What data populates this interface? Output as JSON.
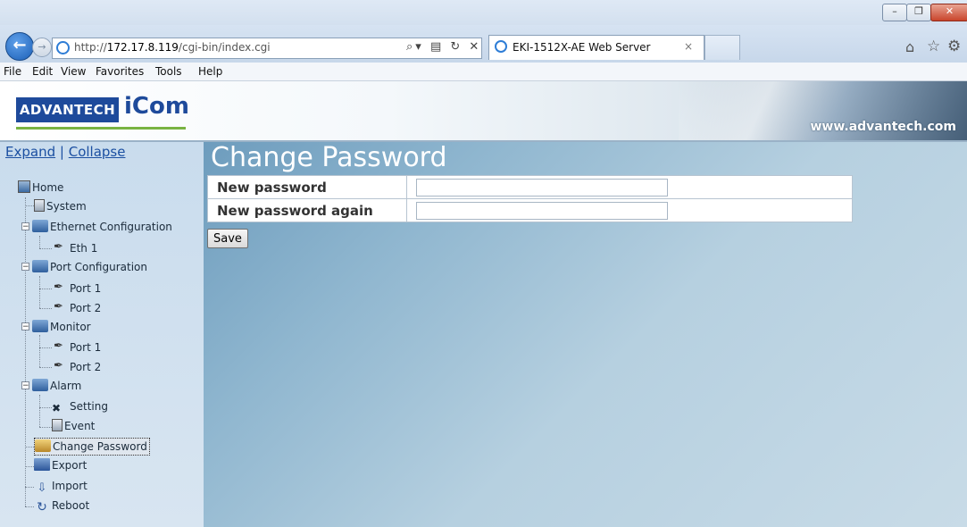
{
  "browser": {
    "window_buttons": {
      "minimize": "–",
      "maximize": "❐",
      "close": "✕"
    },
    "address": {
      "prefix": "http://",
      "host": "172.17.8.119",
      "path": "/cgi-bin/index.cgi",
      "tools": "⌕▾ ▤ ↻ ✕"
    },
    "tab": {
      "label": "EKI-1512X-AE Web Server",
      "close": "×"
    },
    "icons": {
      "home": "⌂",
      "favorites": "☆",
      "settings": "⚙"
    },
    "menu": [
      "File",
      "Edit",
      "View",
      "Favorites",
      "Tools",
      "Help"
    ]
  },
  "header": {
    "brand_primary": "ADVANTECH",
    "brand_secondary": "iCom",
    "url": "www.advantech.com"
  },
  "sidebar": {
    "expand": "Expand",
    "separator": "|",
    "collapse": "Collapse",
    "tree": {
      "home": "Home",
      "system": "System",
      "ethernet": "Ethernet Configuration",
      "eth1": "Eth 1",
      "port_config": "Port Configuration",
      "port_config_p1": "Port 1",
      "port_config_p2": "Port 2",
      "monitor": "Monitor",
      "monitor_p1": "Port 1",
      "monitor_p2": "Port 2",
      "alarm": "Alarm",
      "setting": "Setting",
      "event": "Event",
      "change_password": "Change Password",
      "export": "Export",
      "import": "Import",
      "reboot": "Reboot"
    }
  },
  "main": {
    "title": "Change Password",
    "rows": [
      {
        "label": "New password",
        "value": ""
      },
      {
        "label": "New password again",
        "value": ""
      }
    ],
    "save_label": "Save"
  },
  "colors": {
    "brand_blue": "#1e4a9b",
    "brand_green": "#79b342",
    "link_blue": "#1b4fa1"
  }
}
